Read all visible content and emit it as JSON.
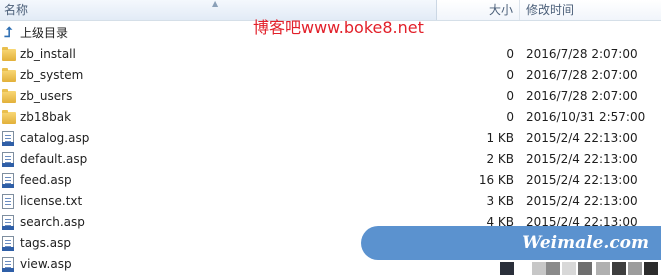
{
  "header": {
    "name_label": "名称",
    "size_label": "大小",
    "date_label": "修改时间"
  },
  "watermark_top": "博客吧www.boke8.net",
  "up_label": "上级目录",
  "files": [
    {
      "name": "zb_install",
      "size": "0",
      "date": "2016/7/28 2:07:00",
      "icon": "folder-icon"
    },
    {
      "name": "zb_system",
      "size": "0",
      "date": "2016/7/28 2:07:00",
      "icon": "folder-icon"
    },
    {
      "name": "zb_users",
      "size": "0",
      "date": "2016/7/28 2:07:00",
      "icon": "folder-icon"
    },
    {
      "name": "zb18bak",
      "size": "0",
      "date": "2016/10/31 2:57:00",
      "icon": "folder-icon"
    },
    {
      "name": "catalog.asp",
      "size": "1 KB",
      "date": "2015/2/4 22:13:00",
      "icon": "asp-file-icon"
    },
    {
      "name": "default.asp",
      "size": "2 KB",
      "date": "2015/2/4 22:13:00",
      "icon": "asp-file-icon"
    },
    {
      "name": "feed.asp",
      "size": "16 KB",
      "date": "2015/2/4 22:13:00",
      "icon": "asp-file-icon"
    },
    {
      "name": "license.txt",
      "size": "3 KB",
      "date": "2015/2/4 22:13:00",
      "icon": "text-file-icon"
    },
    {
      "name": "search.asp",
      "size": "4 KB",
      "date": "2015/2/4 22:13:00",
      "icon": "asp-file-icon"
    },
    {
      "name": "tags.asp",
      "size": "",
      "date": "",
      "icon": "asp-file-icon"
    },
    {
      "name": "view.asp",
      "size": "",
      "date": "",
      "icon": "asp-file-icon"
    }
  ],
  "badge_text": "Weimale.com"
}
